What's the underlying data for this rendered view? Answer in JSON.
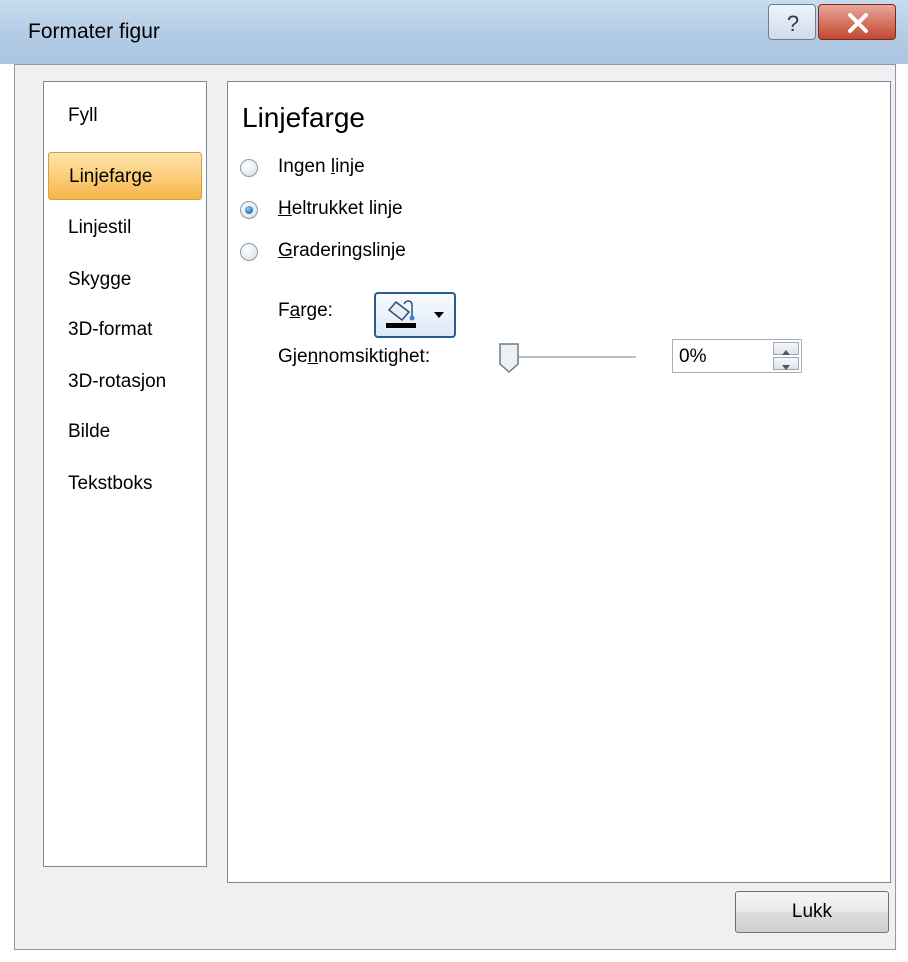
{
  "window": {
    "title": "Formater figur",
    "help_icon": "help-icon",
    "close_icon": "close-icon"
  },
  "nav": {
    "items": [
      {
        "label": "Fyll",
        "selected": false
      },
      {
        "label": "Linjefarge",
        "selected": true
      },
      {
        "label": "Linjestil",
        "selected": false
      },
      {
        "label": "Skygge",
        "selected": false
      },
      {
        "label": "3D-format",
        "selected": false
      },
      {
        "label": "3D-rotasjon",
        "selected": false
      },
      {
        "label": "Bilde",
        "selected": false
      },
      {
        "label": "Tekstboks",
        "selected": false
      }
    ]
  },
  "panel": {
    "heading": "Linjefarge",
    "options": [
      {
        "label_pre": "Ingen ",
        "label_ul": "l",
        "label_post": "inje",
        "selected": false
      },
      {
        "label_pre": "",
        "label_ul": "H",
        "label_post": "eltrukket linje",
        "selected": true
      },
      {
        "label_pre": "",
        "label_ul": "G",
        "label_post": "raderingslinje",
        "selected": false
      }
    ],
    "color": {
      "label_pre": "F",
      "label_ul": "a",
      "label_post": "rge:",
      "icon": "paint-bucket-icon",
      "swatch": "#000000"
    },
    "transparency": {
      "label_pre": "Gje",
      "label_ul": "n",
      "label_post": "nomsiktighet:",
      "value": "0%",
      "level": 0
    }
  },
  "footer": {
    "close_label": "Lukk"
  },
  "colors": {
    "title_bar": "#b4cde6",
    "close_button": "#c3462e",
    "selected_item": "#fbcf7b",
    "radio_selected": "#1f6fb8"
  }
}
